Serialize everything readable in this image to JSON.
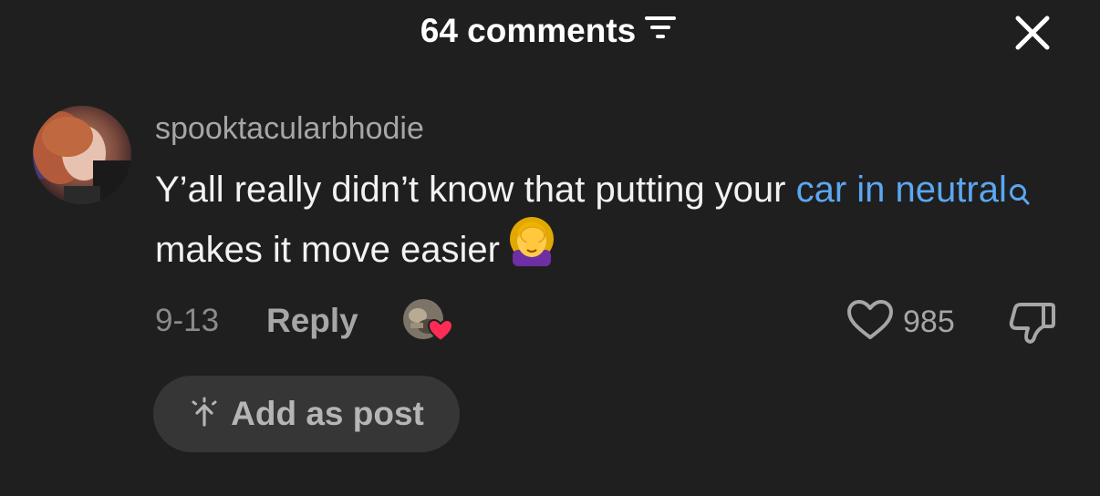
{
  "header": {
    "title": "64 comments",
    "sort_icon": "sort-lines-icon",
    "close_icon": "close-icon"
  },
  "comment": {
    "username": "spooktacularbhodie",
    "text_before_link": "Y’all really didn’t know that putting your ",
    "link_text": "car in neutral",
    "text_after_link": " makes it move easier",
    "emoji": "face-palm-emoji",
    "date": "9-13",
    "reply_label": "Reply",
    "like_count": "985",
    "add_as_post_label": "Add as post"
  },
  "colors": {
    "background": "#1f1f1f",
    "link": "#5ba7f2",
    "muted_text": "#a6a6a6",
    "button_bg": "#363636",
    "creator_heart": "#fe2c55"
  }
}
